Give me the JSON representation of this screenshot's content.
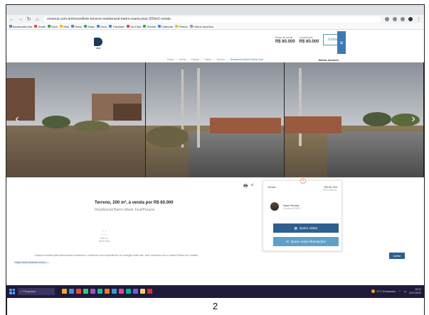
{
  "browser": {
    "url": "vivareal.com.br/imovel/lote-terreno-residencial-bairro-maria-jose-200m2-venda",
    "bookmarks": [
      {
        "label": "Bookmarks Bar",
        "color": "#4285f4"
      },
      {
        "label": "Gmail",
        "color": "#ea4335"
      },
      {
        "label": "Drive",
        "color": "#34a853"
      },
      {
        "label": "Web",
        "color": "#fbbc05"
      },
      {
        "label": "News",
        "color": "#4285f4"
      },
      {
        "label": "Maps",
        "color": "#34a853"
      },
      {
        "label": "Docs",
        "color": "#4285f4"
      },
      {
        "label": "Translate",
        "color": "#4285f4"
      },
      {
        "label": "YouTube",
        "color": "#ea4335"
      },
      {
        "label": "Sheets",
        "color": "#34a853"
      },
      {
        "label": "Calendar",
        "color": "#4285f4"
      },
      {
        "label": "Photos",
        "color": "#fbbc05"
      },
      {
        "label": "Outros favoritos",
        "color": "#999999"
      }
    ]
  },
  "header": {
    "logo_text": "VIVA",
    "price_label_1": "Preço de venda",
    "price_value_1": "R$ 60.000",
    "price_label_2": "Condomínio",
    "price_value_2": "R$ 60.000",
    "outline_button": "Entrar",
    "cta_icon": "≡"
  },
  "breadcrumbs": {
    "items": [
      "Home",
      "Venda",
      "Paraná",
      "Toledo",
      "Terreno",
      "Residencial Bairro Maria José"
    ],
    "active_index": 5,
    "share_label": "Salvar anúncio"
  },
  "gallery": {
    "prev_label": "‹",
    "next_label": "›"
  },
  "property": {
    "title": "Terreno, 200 m², à venda por R$ 60.000",
    "subtitle": "Residencial Bairro Maria José/Paraná",
    "feature_label": "200 m²",
    "feature_sub": "Área total",
    "print_icon": "🖶",
    "share_icon": "<"
  },
  "contact_card": {
    "left_label": "Venda",
    "price": "R$ 60.000",
    "price_sub": "IPTU não inf.",
    "agent_name": "Raul Pereira",
    "agent_sub": "Corretor CRECI",
    "button_primary": "Quero visitar",
    "button_secondary": "Quero mais informações",
    "close_label": "×"
  },
  "footer": {
    "notice": "Usamos cookies para personalizar conteúdos e melhorar a sua experiência. Ao navegar neste site, você concorda com a nossa Política de Cookies.",
    "accept_label": "Aceitar",
    "status_url": "https://www.vivareal.com.br/..."
  },
  "taskbar": {
    "search_placeholder": "Pesquisar",
    "weather": "27°C Ensolarado",
    "time": "15:22",
    "date": "22/11/2022",
    "apps": [
      "#f5a623",
      "#3a8ee6",
      "#e74c3c",
      "#2ecc71",
      "#9b59b6",
      "#1abc9c",
      "#e67e22",
      "#3498db",
      "#e84393",
      "#00b894",
      "#6c5ce7",
      "#fdcb6e",
      "#d63031"
    ]
  },
  "page_number": "2"
}
